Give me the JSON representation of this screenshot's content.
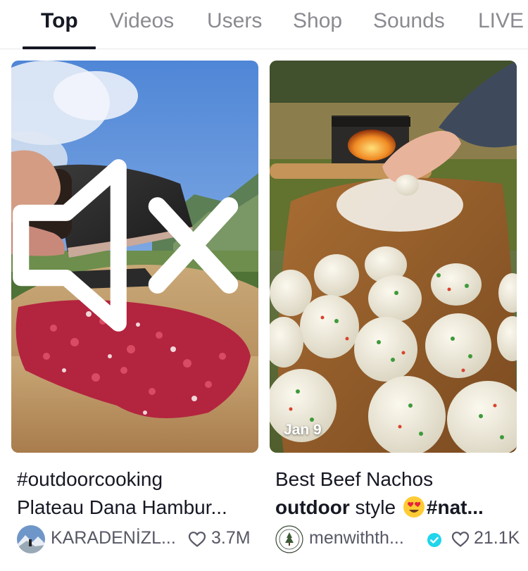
{
  "tabs": [
    {
      "label": "Top",
      "active": true
    },
    {
      "label": "Videos",
      "active": false
    },
    {
      "label": "Users",
      "active": false
    },
    {
      "label": "Shop",
      "active": false
    },
    {
      "label": "Sounds",
      "active": false
    },
    {
      "label": "LIVE",
      "active": false
    }
  ],
  "results": [
    {
      "caption_line1": "#outdoorcooking",
      "caption_line2": "Plateau Dana Hambur...",
      "author": "KARADENİZL...",
      "likes": "3.7M",
      "muted_icon": "speaker-muted-icon"
    },
    {
      "date": "Jan 9",
      "caption_line1": "Best Beef Nachos",
      "caption_line2_bold": "outdoor",
      "caption_line2_rest": " style ",
      "caption_line2_tag": "#nat...",
      "emoji": "heart-eyes-emoji",
      "author": "menwithth...",
      "verified": true,
      "likes": "21.1K"
    }
  ],
  "colors": {
    "text_primary": "#161823",
    "text_secondary": "#565865",
    "tab_inactive": "#8a8b91",
    "verified": "#20d5ec"
  }
}
